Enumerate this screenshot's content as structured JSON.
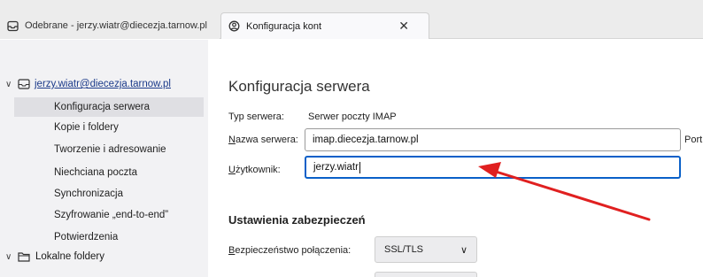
{
  "tabs": [
    {
      "label": "Odebrane - jerzy.wiatr@diecezja.tarnow.pl",
      "icon": "inbox-icon",
      "active": false
    },
    {
      "label": "Konfiguracja kont",
      "icon": "account-settings-icon",
      "active": true,
      "close_label": "✕"
    }
  ],
  "sidebar": {
    "account": {
      "label": "jerzy.wiatr@diecezja.tarnow.pl",
      "twisty": "∨",
      "icon": "mail-account-icon"
    },
    "items": [
      {
        "label": "Konfiguracja serwera",
        "selected": true
      },
      {
        "label": "Kopie i foldery"
      },
      {
        "label": "Tworzenie i adresowanie"
      },
      {
        "label": "Niechciana poczta"
      },
      {
        "label": "Synchronizacja"
      },
      {
        "label": "Szyfrowanie „end-to-end”"
      },
      {
        "label": "Potwierdzenia"
      }
    ],
    "local_folders": {
      "label": "Lokalne foldery",
      "twisty": "∨",
      "icon": "folder-icon"
    }
  },
  "main": {
    "title": "Konfiguracja serwera",
    "server_type_label": "Typ serwera:",
    "server_type_value": "Serwer poczty IMAP",
    "server_name_label_accesskey": "N",
    "server_name_label_rest": "azwa serwera:",
    "server_name_value": "imap.diecezja.tarnow.pl",
    "port_label": "Port",
    "username_label_accesskey": "U",
    "username_label_rest": "żytkownik:",
    "username_value": "jerzy.wiatr",
    "security_section_title": "Ustawienia zabezpieczeń",
    "connection_security_label_accesskey": "B",
    "connection_security_label_rest": "ezpieczeństwo połączenia:",
    "connection_security_value": "SSL/TLS",
    "dropdown_chevron": "∨"
  },
  "colors": {
    "annotation_arrow": "#e02020",
    "focus_ring": "#0a60c8",
    "account_link": "#1b3a8a"
  }
}
